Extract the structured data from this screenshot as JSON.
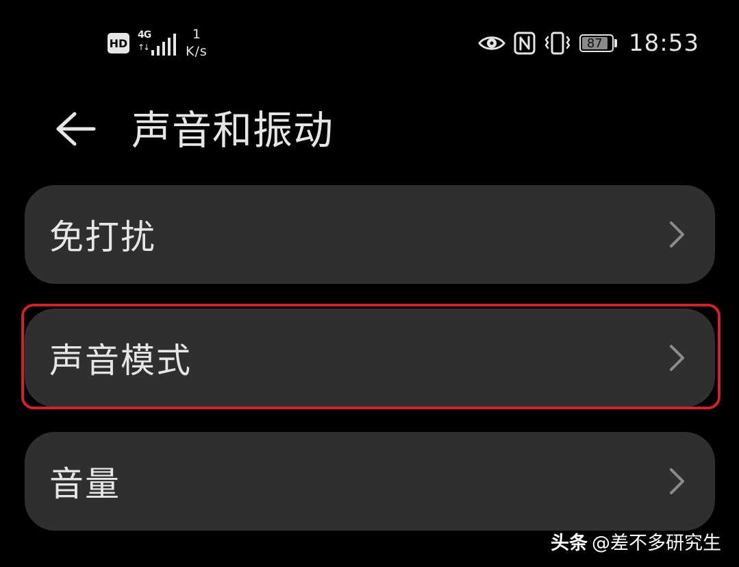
{
  "status_bar": {
    "hd_badge": "HD",
    "network_type": "4G",
    "network_arrows": "↑↓",
    "speed_value": "1",
    "speed_unit": "K/s",
    "battery_level": "87",
    "battery_fraction": 0.87,
    "time": "18:53",
    "icons": [
      "eye-comfort-icon",
      "nfc-icon",
      "vibrate-icon",
      "battery-icon"
    ]
  },
  "header": {
    "back_icon": "back-arrow-icon",
    "title": "声音和振动"
  },
  "settings_list": {
    "items": [
      {
        "label": "免打扰",
        "icon": "chevron-right-icon"
      },
      {
        "label": "声音模式",
        "icon": "chevron-right-icon",
        "highlighted": true
      },
      {
        "label": "音量",
        "icon": "chevron-right-icon"
      }
    ]
  },
  "watermark": {
    "brand": "头条",
    "handle": "@差不多研究生"
  },
  "colors": {
    "background": "#000000",
    "card": "#2f2f2f",
    "text": "#e6e6e6",
    "chevron": "#8c8c8c",
    "highlight": "#d1222c"
  }
}
